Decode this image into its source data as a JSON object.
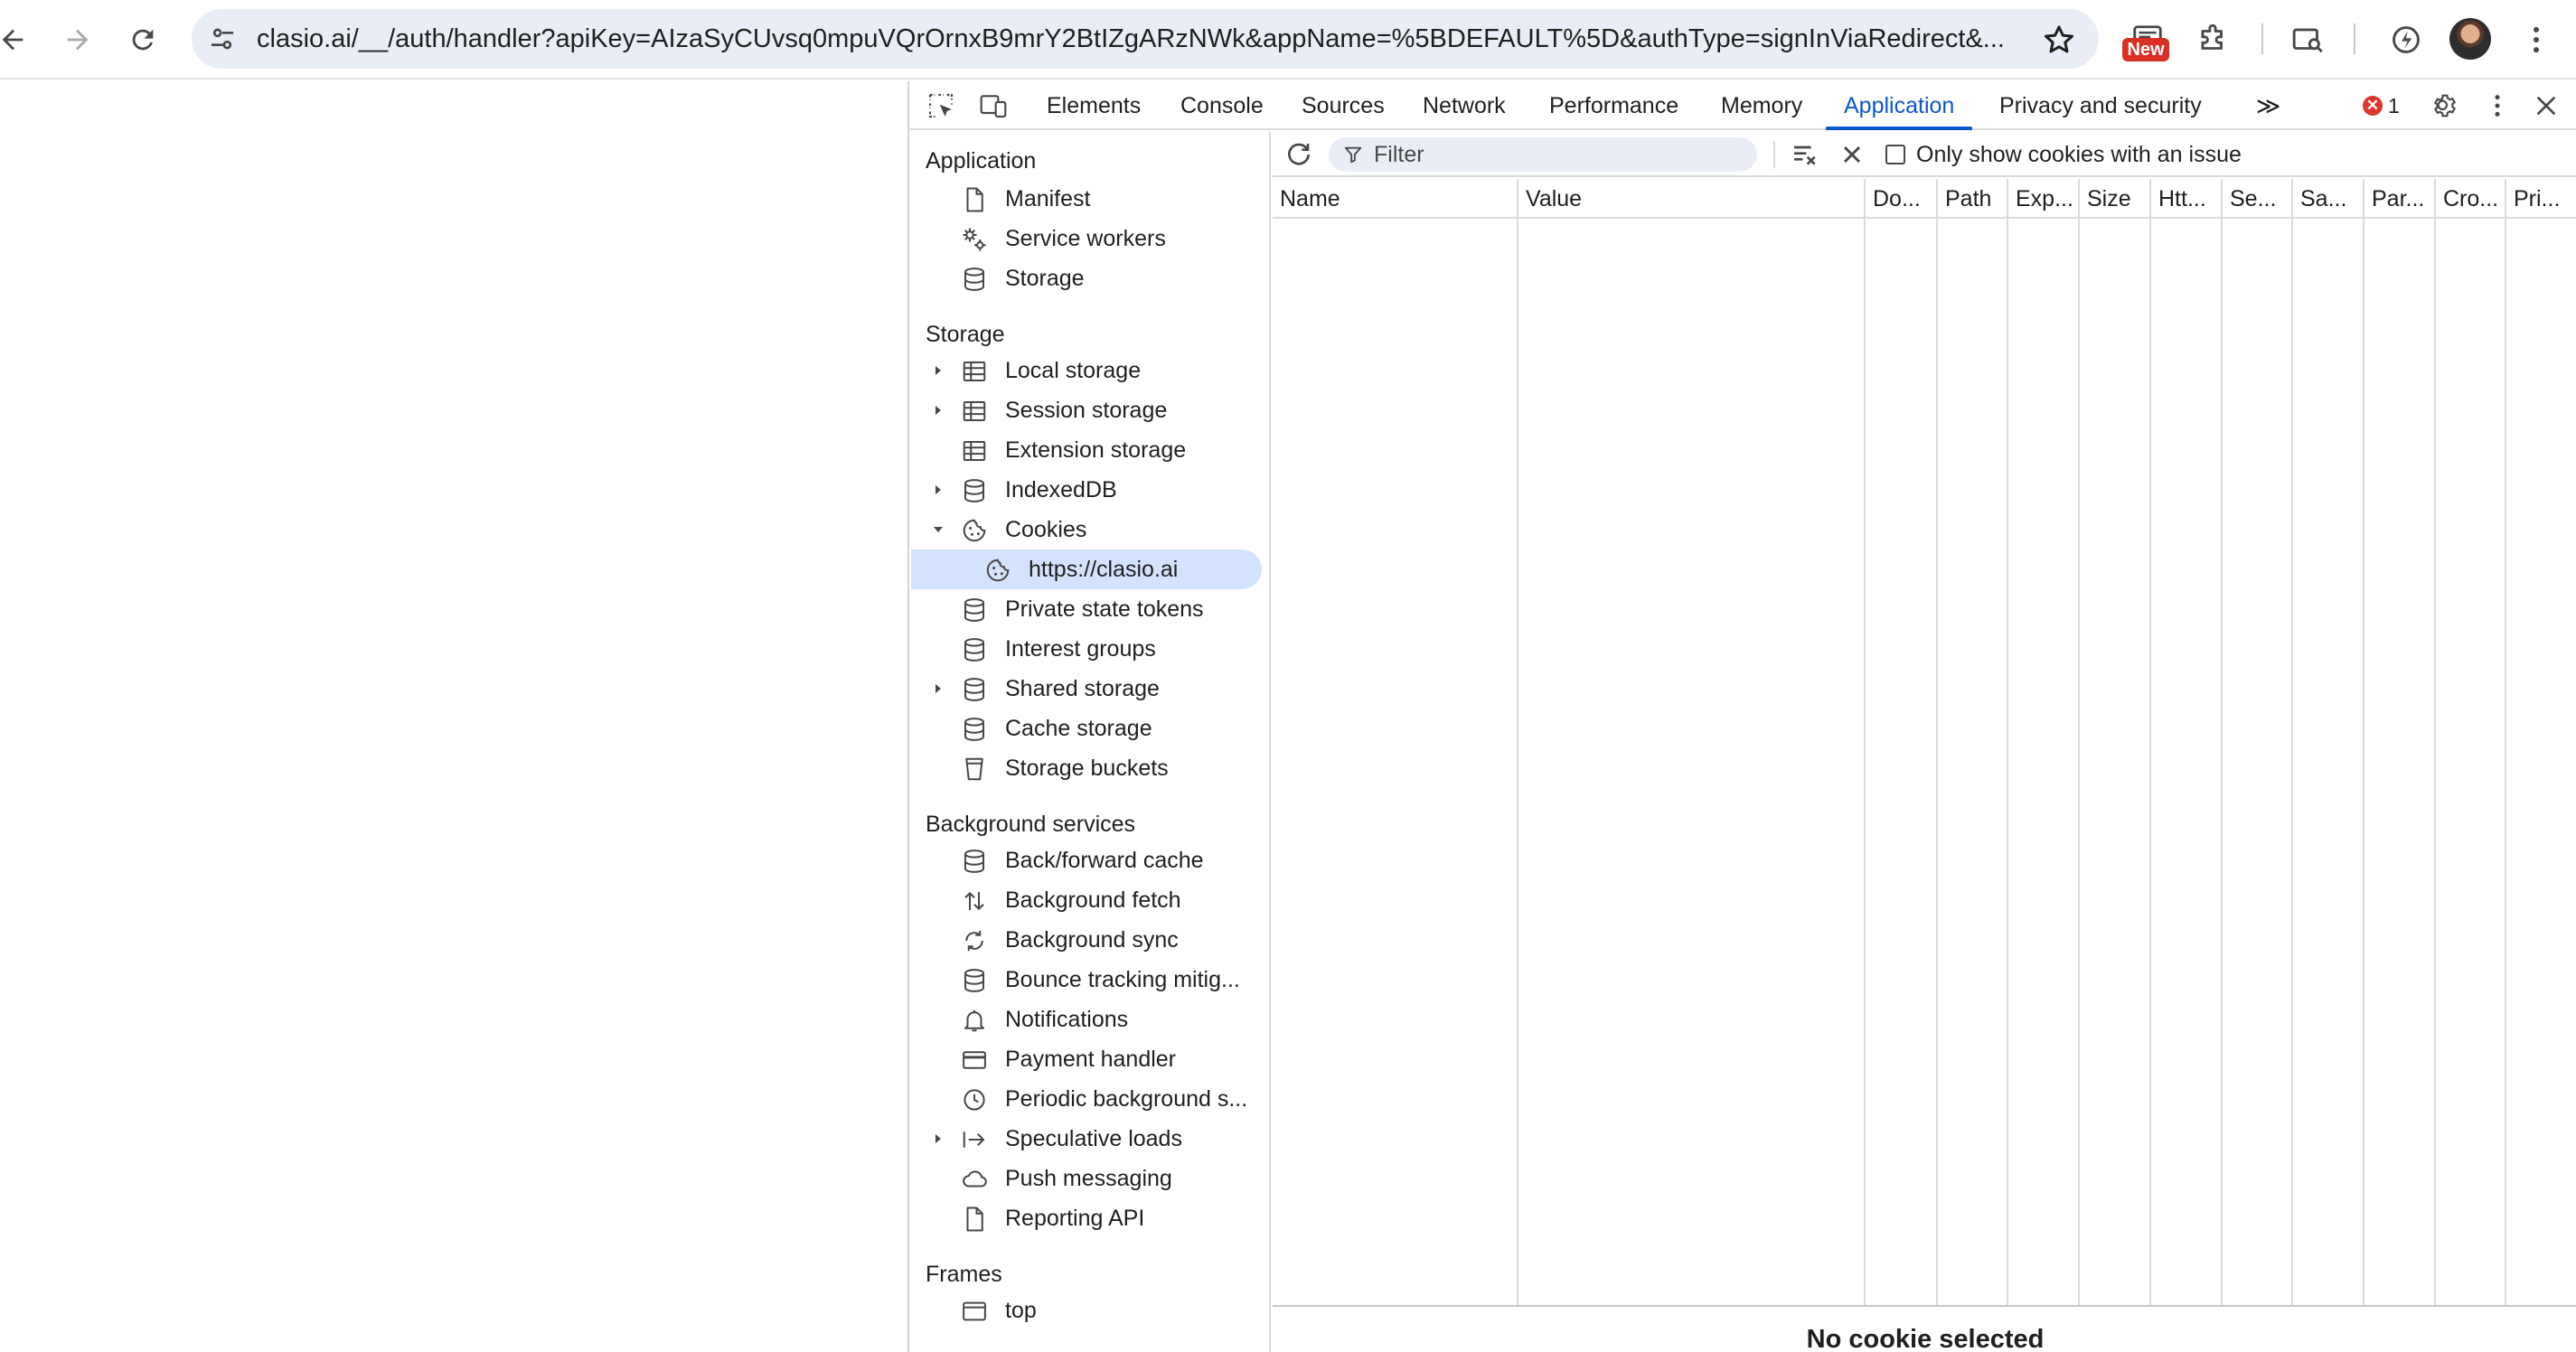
{
  "browser": {
    "url": "clasio.ai/__/auth/handler?apiKey=AIzaSyCUvsq0mpuVQrOrnxB9mrY2BtIZgARzNWk&appName=%5BDEFAULT%5D&authType=signInViaRedirect&...",
    "new_badge": "New",
    "icons": [
      "back-icon",
      "forward-icon",
      "reload-icon",
      "site-settings-icon",
      "star-icon",
      "extension-new-icon",
      "puzzle-icon",
      "cast-search-icon",
      "performance-icon",
      "avatar",
      "menu-icon"
    ]
  },
  "devtools": {
    "tabs": [
      {
        "label": "Elements"
      },
      {
        "label": "Console"
      },
      {
        "label": "Sources"
      },
      {
        "label": "Network"
      },
      {
        "label": "Performance"
      },
      {
        "label": "Memory"
      },
      {
        "label": "Application",
        "active": true
      },
      {
        "label": "Privacy and security"
      }
    ],
    "more_tabs": "≫",
    "error_count": "1",
    "error_glyph": "✕",
    "accent": "#0b57d0",
    "sidebar": {
      "application_header": "Application",
      "application_items": [
        "Manifest",
        "Service workers",
        "Storage"
      ],
      "storage_header": "Storage",
      "storage_items": [
        "Local storage",
        "Session storage",
        "Extension storage",
        "IndexedDB",
        "Cookies",
        "https://clasio.ai",
        "Private state tokens",
        "Interest groups",
        "Shared storage",
        "Cache storage",
        "Storage buckets"
      ],
      "background_header": "Background services",
      "background_items": [
        "Back/forward cache",
        "Background fetch",
        "Background sync",
        "Bounce tracking mitig...",
        "Notifications",
        "Payment handler",
        "Periodic background s...",
        "Speculative loads",
        "Push messaging",
        "Reporting API"
      ],
      "frames_header": "Frames",
      "frames_items": [
        "top"
      ],
      "selected_item": "https://clasio.ai",
      "selected_color": "#d3e3fd"
    },
    "cookies": {
      "filter_placeholder": "Filter",
      "only_issues_label": "Only show cookies with an issue",
      "only_issues_checked": false,
      "columns": [
        "Name",
        "Value",
        "Do...",
        "Path",
        "Exp...",
        "Size",
        "Htt...",
        "Se...",
        "Sa...",
        "Par...",
        "Cro...",
        "Pri..."
      ],
      "rows": [],
      "empty_message": "No cookie selected"
    }
  }
}
